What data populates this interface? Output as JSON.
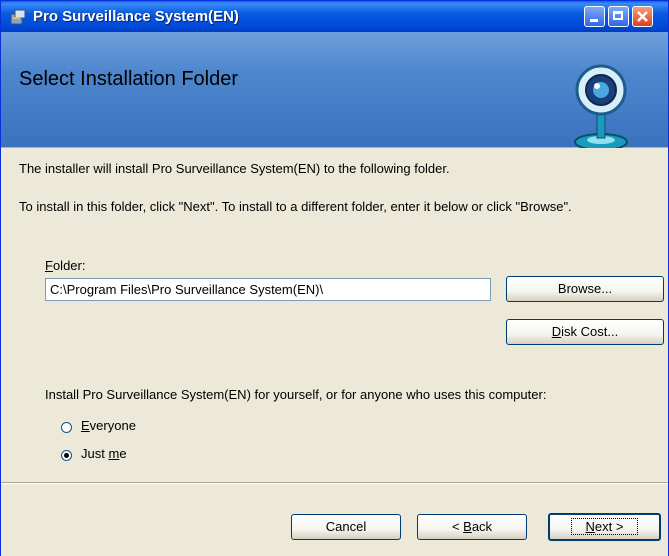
{
  "window": {
    "title": "Pro Surveillance System(EN)",
    "accent": "#0A5BE0"
  },
  "banner": {
    "title": "Select Installation Folder",
    "logo_icon": "webcam-logo-icon"
  },
  "content": {
    "intro_line1": "The installer will install Pro Surveillance System(EN) to the following folder.",
    "intro_line2": "To install in this folder, click \"Next\". To install to a different folder, enter it below or click \"Browse\".",
    "folder_label_mnemonic": "F",
    "folder_label_rest": "older:",
    "folder_value": "C:\\Program Files\\Pro Surveillance System(EN)\\",
    "browse_label": "Browse...",
    "disk_cost_mnemonic": "D",
    "disk_cost_rest": "isk Cost...",
    "install_for_text": "Install Pro Surveillance System(EN) for yourself, or for anyone who uses this computer:",
    "radio_everyone_mnemonic": "E",
    "radio_everyone_rest": "veryone",
    "radio_justme_prefix": "Just ",
    "radio_justme_mnemonic": "m",
    "radio_justme_rest": "e",
    "selected_option": "Just me"
  },
  "footer": {
    "cancel_label": "Cancel",
    "back_prefix": "< ",
    "back_mnemonic": "B",
    "back_rest": "ack",
    "next_mnemonic": "N",
    "next_rest": "ext >"
  }
}
